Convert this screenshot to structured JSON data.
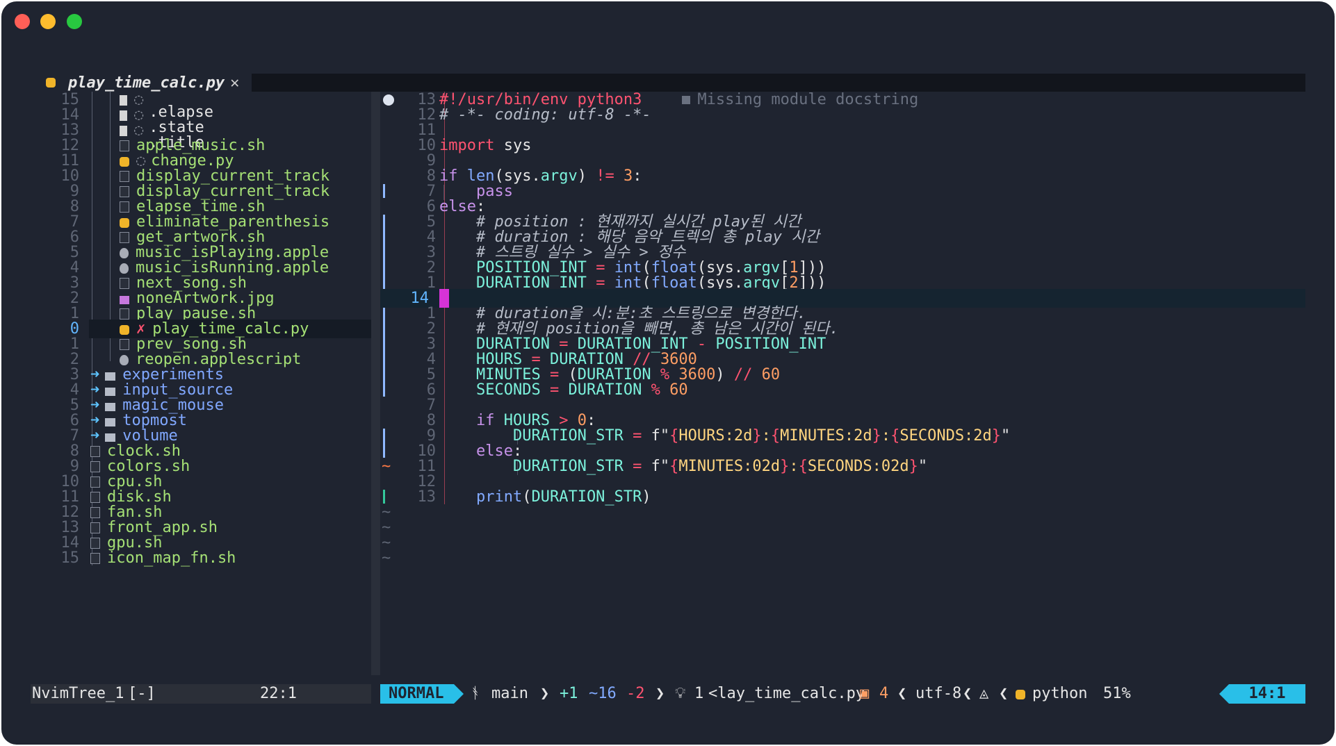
{
  "window": {
    "traffic_lights": [
      "close",
      "minimize",
      "zoom"
    ]
  },
  "tab": {
    "filename": "play_time_calc.py",
    "close_glyph": "✕",
    "icon": "python-icon"
  },
  "tree": {
    "rows": [
      {
        "num": "15",
        "name": ".elapse",
        "icon": "doc",
        "circle": "◌",
        "kind": "dot"
      },
      {
        "num": "14",
        "name": ".state",
        "icon": "doc",
        "circle": "◌",
        "kind": "dot"
      },
      {
        "num": "13",
        "name": ".title",
        "icon": "doc",
        "circle": "◌",
        "kind": "dot"
      },
      {
        "num": "12",
        "name": "apple_music.sh",
        "icon": "file",
        "kind": "file"
      },
      {
        "num": "11",
        "name": "change.py",
        "icon": "py",
        "circle": "◌",
        "kind": "file"
      },
      {
        "num": "10",
        "name": "display_current_track",
        "icon": "file",
        "kind": "file"
      },
      {
        "num": "9",
        "name": "display_current_track",
        "icon": "file",
        "kind": "file"
      },
      {
        "num": "8",
        "name": "elapse_time.sh",
        "icon": "file",
        "kind": "file"
      },
      {
        "num": "7",
        "name": "eliminate_parenthesis",
        "icon": "py",
        "kind": "file"
      },
      {
        "num": "6",
        "name": "get_artwork.sh",
        "icon": "file",
        "kind": "file"
      },
      {
        "num": "5",
        "name": "music_isPlaying.apple",
        "icon": "apple",
        "kind": "file"
      },
      {
        "num": "4",
        "name": "music_isRunning.apple",
        "icon": "apple",
        "kind": "file"
      },
      {
        "num": "3",
        "name": "next_song.sh",
        "icon": "file",
        "kind": "file"
      },
      {
        "num": "2",
        "name": "noneArtwork.jpg",
        "icon": "img",
        "kind": "file"
      },
      {
        "num": "1",
        "name": "play_pause.sh",
        "icon": "file",
        "kind": "file"
      },
      {
        "num": "0",
        "name": "play_time_calc.py",
        "icon": "py",
        "x": "✗",
        "kind": "file",
        "current": true
      },
      {
        "num": "1",
        "name": "prev_song.sh",
        "icon": "file",
        "kind": "file"
      },
      {
        "num": "2",
        "name": "reopen.applescript",
        "icon": "apple",
        "kind": "file"
      },
      {
        "num": "3",
        "name": "experiments",
        "icon": "folder",
        "arrow": "➜",
        "kind": "dir"
      },
      {
        "num": "4",
        "name": "input_source",
        "icon": "folder",
        "arrow": "➜",
        "kind": "dir"
      },
      {
        "num": "5",
        "name": "magic_mouse",
        "icon": "folder",
        "arrow": "➜",
        "kind": "dir"
      },
      {
        "num": "6",
        "name": "topmost",
        "icon": "folder",
        "arrow": "➜",
        "kind": "dir"
      },
      {
        "num": "7",
        "name": "volume",
        "icon": "folder",
        "arrow": "➜",
        "kind": "dir"
      },
      {
        "num": "8",
        "name": "clock.sh",
        "icon": "file",
        "kind": "file"
      },
      {
        "num": "9",
        "name": "colors.sh",
        "icon": "file",
        "kind": "file"
      },
      {
        "num": "10",
        "name": "cpu.sh",
        "icon": "file",
        "kind": "file"
      },
      {
        "num": "11",
        "name": "disk.sh",
        "icon": "file",
        "kind": "file"
      },
      {
        "num": "12",
        "name": "fan.sh",
        "icon": "file",
        "kind": "file"
      },
      {
        "num": "13",
        "name": "front_app.sh",
        "icon": "file",
        "kind": "file"
      },
      {
        "num": "14",
        "name": "gpu.sh",
        "icon": "file",
        "kind": "file"
      },
      {
        "num": "15",
        "name": "icon_map_fn.sh",
        "icon": "file",
        "kind": "file"
      }
    ]
  },
  "editor": {
    "diagnostic": "Missing module docstring",
    "lines": [
      {
        "num": "13",
        "tokens": [
          [
            "kw",
            "#!/usr/bin/env python3"
          ]
        ]
      },
      {
        "num": "12",
        "tokens": [
          [
            "cm",
            "# -*- coding: utf-8 -*-"
          ]
        ]
      },
      {
        "num": "11",
        "tokens": []
      },
      {
        "num": "10",
        "tokens": [
          [
            "kw",
            "import"
          ],
          [
            "",
            " sys"
          ]
        ]
      },
      {
        "num": "9",
        "tokens": []
      },
      {
        "num": "8",
        "tokens": [
          [
            "kw2",
            "if"
          ],
          [
            "",
            " "
          ],
          [
            "fn",
            "len"
          ],
          [
            "",
            "(sys."
          ],
          [
            "cn",
            "argv"
          ],
          [
            "",
            ") "
          ],
          [
            "op",
            "!="
          ],
          [
            "",
            " "
          ],
          [
            "nm",
            "3"
          ],
          [
            "",
            ":"
          ]
        ]
      },
      {
        "num": "7",
        "tokens": [
          [
            "",
            "    "
          ],
          [
            "kw2",
            "pass"
          ]
        ]
      },
      {
        "num": "6",
        "tokens": [
          [
            "kw2",
            "else"
          ],
          [
            "",
            ":"
          ]
        ]
      },
      {
        "num": "5",
        "tokens": [
          [
            "",
            "    "
          ],
          [
            "cm",
            "# position : 현재까지 실시간 play된 시간"
          ]
        ]
      },
      {
        "num": "4",
        "tokens": [
          [
            "",
            "    "
          ],
          [
            "cm",
            "# duration : 해당 음악 트렉의 총 play 시간"
          ]
        ]
      },
      {
        "num": "3",
        "tokens": [
          [
            "",
            "    "
          ],
          [
            "cm",
            "# 스트링 실수 > 실수 > 정수"
          ]
        ]
      },
      {
        "num": "2",
        "tokens": [
          [
            "",
            "    "
          ],
          [
            "cn",
            "POSITION_INT"
          ],
          [
            "",
            " "
          ],
          [
            "op",
            "="
          ],
          [
            "",
            " "
          ],
          [
            "fn",
            "int"
          ],
          [
            "",
            "("
          ],
          [
            "fn",
            "float"
          ],
          [
            "",
            "(sys."
          ],
          [
            "cn",
            "argv"
          ],
          [
            "",
            "["
          ],
          [
            "nm",
            "1"
          ],
          [
            "",
            "]))"
          ]
        ]
      },
      {
        "num": "1",
        "tokens": [
          [
            "",
            "    "
          ],
          [
            "cn",
            "DURATION_INT"
          ],
          [
            "",
            " "
          ],
          [
            "op",
            "="
          ],
          [
            "",
            " "
          ],
          [
            "fn",
            "int"
          ],
          [
            "",
            "("
          ],
          [
            "fn",
            "float"
          ],
          [
            "",
            "(sys."
          ],
          [
            "cn",
            "argv"
          ],
          [
            "",
            "["
          ],
          [
            "nm",
            "2"
          ],
          [
            "",
            "]))"
          ]
        ]
      },
      {
        "num": "14",
        "tokens": [],
        "current": true
      },
      {
        "num": "1",
        "tokens": [
          [
            "",
            "    "
          ],
          [
            "cm",
            "# duration을 시:분:초 스트링으로 변경한다."
          ]
        ]
      },
      {
        "num": "2",
        "tokens": [
          [
            "",
            "    "
          ],
          [
            "cm",
            "# 현재의 position을 빼면, 총 남은 시간이 된다."
          ]
        ]
      },
      {
        "num": "3",
        "tokens": [
          [
            "",
            "    "
          ],
          [
            "cn",
            "DURATION"
          ],
          [
            "",
            " "
          ],
          [
            "op",
            "="
          ],
          [
            "",
            " "
          ],
          [
            "cn",
            "DURATION_INT"
          ],
          [
            "",
            " "
          ],
          [
            "op",
            "-"
          ],
          [
            "",
            " "
          ],
          [
            "cn",
            "POSITION_INT"
          ]
        ]
      },
      {
        "num": "4",
        "tokens": [
          [
            "",
            "    "
          ],
          [
            "cn",
            "HOURS"
          ],
          [
            "",
            " "
          ],
          [
            "op",
            "="
          ],
          [
            "",
            " "
          ],
          [
            "cn",
            "DURATION"
          ],
          [
            "",
            " "
          ],
          [
            "op",
            "//"
          ],
          [
            "",
            " "
          ],
          [
            "nm",
            "3600"
          ]
        ]
      },
      {
        "num": "5",
        "tokens": [
          [
            "",
            "    "
          ],
          [
            "cn",
            "MINUTES"
          ],
          [
            "",
            " "
          ],
          [
            "op",
            "="
          ],
          [
            "",
            " ("
          ],
          [
            "cn",
            "DURATION"
          ],
          [
            "",
            " "
          ],
          [
            "op",
            "%"
          ],
          [
            "",
            " "
          ],
          [
            "nm",
            "3600"
          ],
          [
            "",
            ") "
          ],
          [
            "op",
            "//"
          ],
          [
            "",
            " "
          ],
          [
            "nm",
            "60"
          ]
        ]
      },
      {
        "num": "6",
        "tokens": [
          [
            "",
            "    "
          ],
          [
            "cn",
            "SECONDS"
          ],
          [
            "",
            " "
          ],
          [
            "op",
            "="
          ],
          [
            "",
            " "
          ],
          [
            "cn",
            "DURATION"
          ],
          [
            "",
            " "
          ],
          [
            "op",
            "%"
          ],
          [
            "",
            " "
          ],
          [
            "nm",
            "60"
          ]
        ]
      },
      {
        "num": "7",
        "tokens": []
      },
      {
        "num": "8",
        "tokens": [
          [
            "",
            "    "
          ],
          [
            "kw2",
            "if"
          ],
          [
            "",
            " "
          ],
          [
            "cn",
            "HOURS"
          ],
          [
            "",
            " "
          ],
          [
            "op",
            ">"
          ],
          [
            "",
            " "
          ],
          [
            "nm",
            "0"
          ],
          [
            "",
            ":"
          ]
        ]
      },
      {
        "num": "9",
        "tokens": [
          [
            "",
            "        "
          ],
          [
            "cn",
            "DURATION_STR"
          ],
          [
            "",
            " "
          ],
          [
            "op",
            "="
          ],
          [
            "",
            " f\""
          ],
          [
            "op",
            "{"
          ],
          [
            "st",
            "HOURS:2d"
          ],
          [
            "op",
            "}"
          ],
          [
            "st",
            ":"
          ],
          [
            "op",
            "{"
          ],
          [
            "st",
            "MINUTES:2d"
          ],
          [
            "op",
            "}"
          ],
          [
            "st",
            ":"
          ],
          [
            "op",
            "{"
          ],
          [
            "st",
            "SECONDS:2d"
          ],
          [
            "op",
            "}"
          ],
          [
            "",
            "\""
          ]
        ]
      },
      {
        "num": "10",
        "tokens": [
          [
            "",
            "    "
          ],
          [
            "kw2",
            "else"
          ],
          [
            "",
            ":"
          ]
        ]
      },
      {
        "num": "11",
        "tokens": [
          [
            "",
            "        "
          ],
          [
            "cn",
            "DURATION_STR"
          ],
          [
            "",
            " "
          ],
          [
            "op",
            "="
          ],
          [
            "",
            " f\""
          ],
          [
            "op",
            "{"
          ],
          [
            "st",
            "MINUTES:02d"
          ],
          [
            "op",
            "}"
          ],
          [
            "st",
            ":"
          ],
          [
            "op",
            "{"
          ],
          [
            "st",
            "SECONDS:02d"
          ],
          [
            "op",
            "}"
          ],
          [
            "",
            "\""
          ]
        ]
      },
      {
        "num": "12",
        "tokens": []
      },
      {
        "num": "13",
        "tokens": [
          [
            "",
            "    "
          ],
          [
            "fn",
            "print"
          ],
          [
            "",
            "("
          ],
          [
            "cn",
            "DURATION_STR"
          ],
          [
            "",
            ")"
          ]
        ]
      }
    ],
    "tilde": "~",
    "colors": {
      "background": "#1f2430",
      "keyword": "#ff5370",
      "keyword2": "#c792ea",
      "function": "#82aaff",
      "constant": "#7cf2dc",
      "number": "#ff9e64",
      "string": "#ffd580",
      "git_change_bar": "#8fb8ff",
      "cursor": "#d633d6"
    }
  },
  "statusline": {
    "tree_name": "NvimTree_1",
    "tree_flag": "[-]",
    "tree_pos": "22:1",
    "mode": "NORMAL",
    "branch_icon": "git-branch-icon",
    "branch": "main",
    "added": "+1",
    "changed": "~16",
    "removed": "-2",
    "lsp_icon": "lightbulb-icon",
    "lsp_count": "1",
    "filename": "<lay_time_calc.py",
    "warn_icon": "package-icon",
    "warn_count": "4",
    "encoding": "utf-8",
    "os_icon": "apple-icon",
    "filetype": "python",
    "progress": "51%",
    "position": "14:1",
    "accent": "#29bfe8"
  }
}
